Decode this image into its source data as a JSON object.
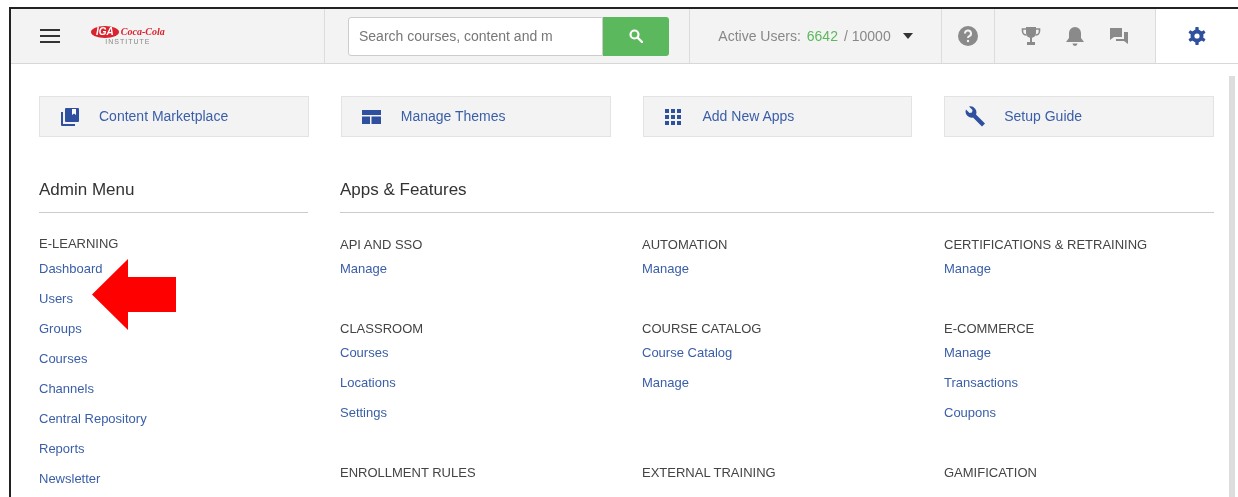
{
  "header": {
    "logo": {
      "mark": "IGA",
      "script": "Coca-Cola",
      "caption": "INSTITUTE"
    },
    "search": {
      "placeholder": "Search courses, content and m"
    },
    "active_users": {
      "label": "Active Users:",
      "count": "6642",
      "limit": "/ 10000"
    }
  },
  "quick_links": [
    {
      "kind": "marketplace",
      "label": "Content Marketplace"
    },
    {
      "kind": "themes",
      "label": "Manage Themes"
    },
    {
      "kind": "apps",
      "label": "Add New Apps"
    },
    {
      "kind": "guide",
      "label": "Setup Guide"
    }
  ],
  "admin_menu": {
    "title": "Admin Menu",
    "section": "E-LEARNING",
    "items": [
      "Dashboard",
      "Users",
      "Groups",
      "Courses",
      "Channels",
      "Central Repository",
      "Reports",
      "Newsletter"
    ]
  },
  "apps_features": {
    "title": "Apps & Features",
    "sections": [
      {
        "title": "API AND SSO",
        "links": [
          "Manage"
        ]
      },
      {
        "title": "AUTOMATION",
        "links": [
          "Manage"
        ]
      },
      {
        "title": "CERTIFICATIONS & RETRAINING",
        "links": [
          "Manage"
        ]
      },
      {
        "title": "CLASSROOM",
        "links": [
          "Courses",
          "Locations",
          "Settings"
        ]
      },
      {
        "title": "COURSE CATALOG",
        "links": [
          "Course Catalog",
          "Manage"
        ]
      },
      {
        "title": "E-COMMERCE",
        "links": [
          "Manage",
          "Transactions",
          "Coupons"
        ]
      },
      {
        "title": "ENROLLMENT RULES"
      },
      {
        "title": "EXTERNAL TRAINING"
      },
      {
        "title": "GAMIFICATION"
      }
    ]
  }
}
